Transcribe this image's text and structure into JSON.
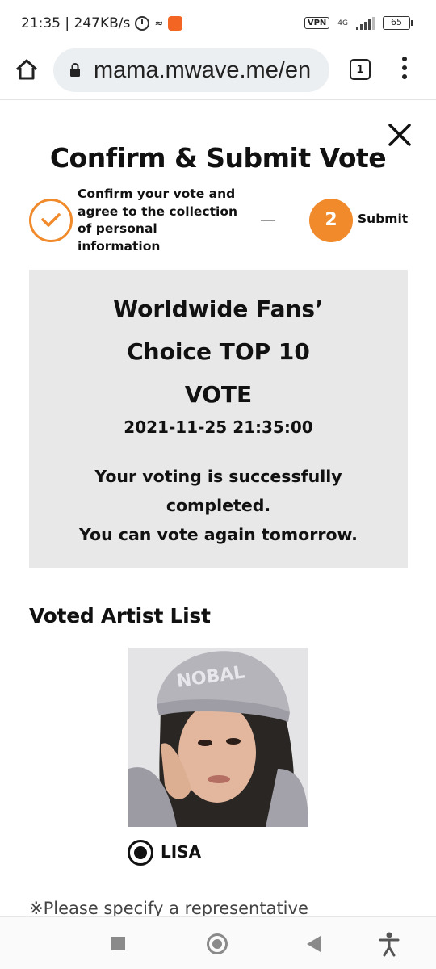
{
  "status_bar": {
    "time_speed": "21:35 | 247KB/s",
    "vpn": "VPN",
    "network": "4G",
    "battery": "65"
  },
  "browser": {
    "url": "mama.mwave.me/en",
    "tab_count": "1"
  },
  "dialog": {
    "title": "Confirm & Submit Vote",
    "step1_label": "Confirm your vote and agree to the collection of personal information",
    "step2_number": "2",
    "step2_label": "Submit"
  },
  "result": {
    "vote_title": "Worldwide Fans’ Choice TOP 10 VOTE",
    "datetime": "2021-11-25 21:35:00",
    "message_line1": "Your voting is successfully completed.",
    "message_line2": "You can vote again tomorrow."
  },
  "voted_list": {
    "title": "Voted Artist List",
    "artist_name": "LISA"
  },
  "note": "※Please specify a representative",
  "colors": {
    "accent": "#f08a2b",
    "result_bg": "#e8e8e8"
  },
  "icons": [
    "home-icon",
    "lock-icon",
    "tabs-icon",
    "more-vert-icon",
    "close-icon",
    "check-icon",
    "radio-selected-icon",
    "recents-icon",
    "nav-home-icon",
    "back-icon",
    "accessibility-icon"
  ]
}
